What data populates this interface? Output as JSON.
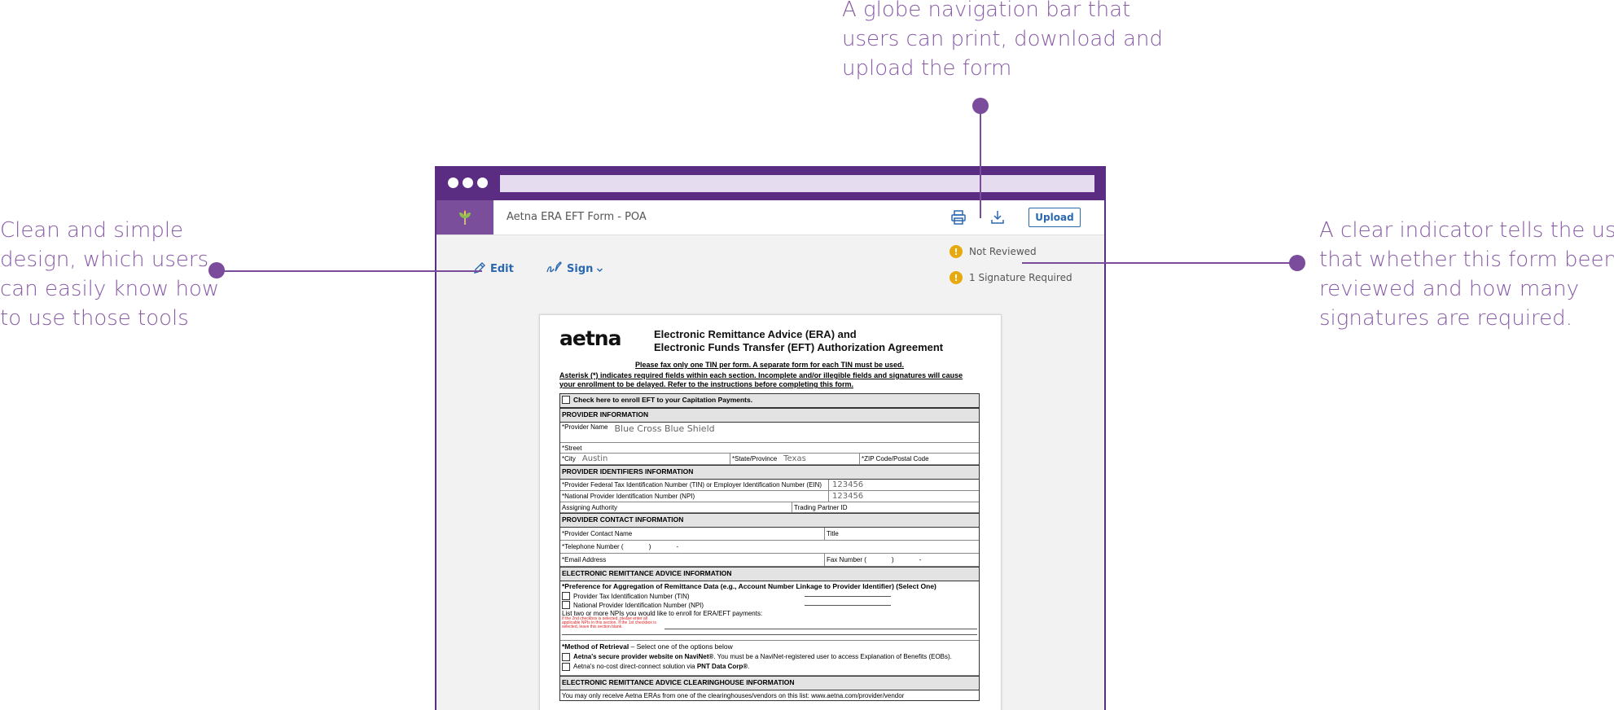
{
  "callouts": {
    "top": [
      "A globe navigation bar that",
      "users can print, download and",
      "upload the form"
    ],
    "left": [
      "Clean and simple",
      "design, which users",
      "can easily know how",
      "to use those tools"
    ],
    "right": [
      "A clear indicator tells the user",
      "that whether this form been",
      "reviewed and how many",
      "signatures are required."
    ]
  },
  "app": {
    "title": "Aetna ERA EFT Form - POA",
    "upload_label": "Upload",
    "icons": [
      "leaf-logo-icon",
      "print-icon",
      "download-icon"
    ]
  },
  "toolbar": {
    "edit_label": "Edit",
    "sign_label": "Sign"
  },
  "status": {
    "review": "Not Reviewed",
    "signatures": "1 Signature Required",
    "icon": "warning-icon"
  },
  "colors": {
    "brand_purple": "#5a2d82",
    "accent_blue": "#2a68b0",
    "warning": "#e8a90f",
    "callout_text": "#8a5ca8"
  },
  "doc": {
    "logo": "aetna",
    "title_line1": "Electronic Remittance Advice (ERA) and",
    "title_line2": "Electronic Funds Transfer (EFT) Authorization Agreement",
    "fax_note": "Please fax only one TIN per form. A separate form for each TIN must be used.",
    "asterisk_note": "Asterisk (*) indicates required fields within each section. Incomplete and/or illegible fields and signatures will cause your enrollment to be delayed. Refer to the instructions before completing this form.",
    "capitation": "Check here to enroll EFT to your Capitation Payments.",
    "sec_provider": "PROVIDER INFORMATION",
    "provider_name_label": "*Provider Name",
    "provider_name": "Blue Cross Blue Shield",
    "street_label": "*Street",
    "city_label": "*City",
    "city": "Austin",
    "state_label": "*State/Province",
    "state": "Texas",
    "zip_label": "*ZIP Code/Postal Code",
    "sec_identifiers": "PROVIDER IDENTIFIERS INFORMATION",
    "tin_label": "*Provider Federal Tax Identification Number (TIN) or Employer Identification Number (EIN)",
    "tin": "123456",
    "npi_label": "*National Provider Identification Number (NPI)",
    "npi": "123456",
    "assigning_label": "Assigning Authority",
    "trading_label": "Trading Partner ID",
    "sec_contact": "PROVIDER CONTACT INFORMATION",
    "contact_name_label": "*Provider Contact Name",
    "title_label": "Title",
    "phone_label": "*Telephone Number (              )              -",
    "email_label": "*Email Address",
    "fax_label": "Fax Number (              )              -",
    "sec_era": "ELECTRONIC REMITTANCE ADVICE INFORMATION",
    "preference": "*Preference for Aggregation of Remittance Data (e.g., Account Number Linkage to Provider Identifier) (Select One)",
    "opt_tin": "Provider Tax Identification Number (TIN)",
    "opt_npi": "National Provider Identification Number (NPI)",
    "list_npis": "List two or more NPIs you would like to enroll for ERA/EFT payments:",
    "red_note": "If the 2nd checkbox is selected, please enter all applicable NPIs in this section. If the 1st checkbox is selected, leave this section blank.",
    "method": "*Method of Retrieval",
    "method_suffix": " – Select one of the options below",
    "navinet_bold": "Aetna's secure provider website on NaviNet®",
    "navinet_rest": ". You must be a NaviNet-registered user to access Explanation of Benefits (EOBs).",
    "pnt_text": "Aetna's no-cost direct-connect solution via ",
    "pnt_bold": "PNT Data Corp®",
    "sec_clearinghouse": "ELECTRONIC REMITTANCE ADVICE CLEARINGHOUSE INFORMATION",
    "clearinghouse_note": "You may only receive Aetna ERAs from one of the clearinghouses/vendors on this list: www.aetna.com/provider/vendor"
  }
}
